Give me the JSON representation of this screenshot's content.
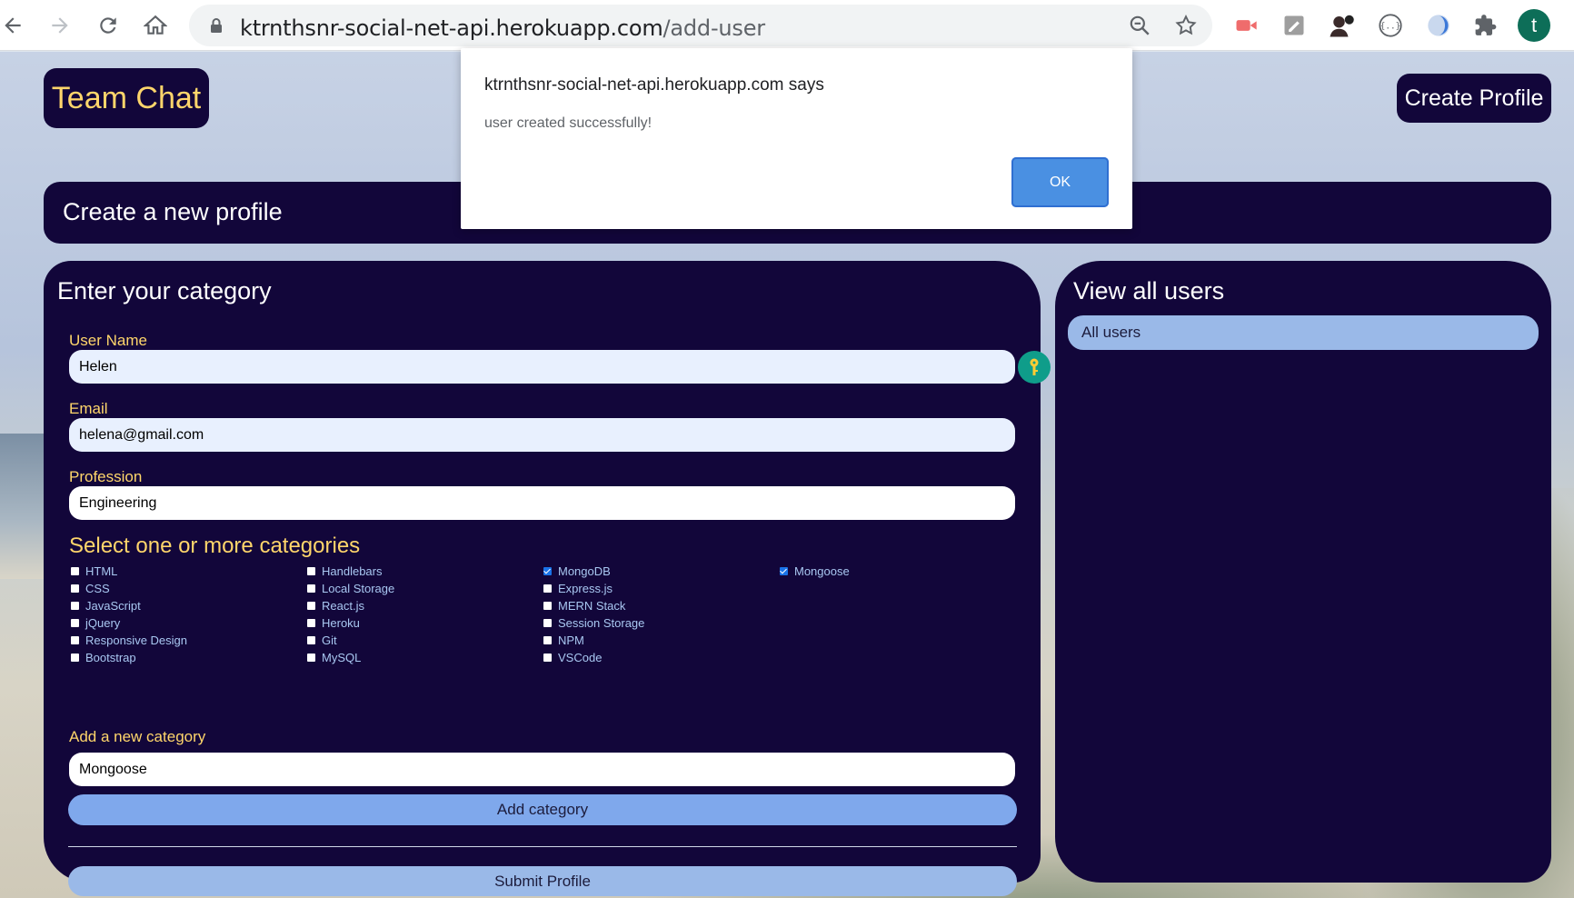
{
  "browser": {
    "url_host": "ktrnthsnr-social-net-api.herokuapp.com",
    "url_path": "/add-user",
    "profile_initial": "t",
    "icons": [
      "back-icon",
      "forward-icon",
      "reload-icon",
      "home-icon",
      "lock-icon",
      "zoom-icon",
      "star-icon",
      "extensions-icon"
    ]
  },
  "header": {
    "brand": "Team Chat",
    "create_profile": "Create Profile"
  },
  "page_title": "Create a new profile",
  "form": {
    "title": "Enter your category",
    "username_label": "User Name",
    "username_value": "Helen",
    "email_label": "Email",
    "email_value": "helena@gmail.com",
    "profession_label": "Profession",
    "profession_value": "Engineering",
    "categories_title": "Select one or more categories",
    "categories": [
      {
        "label": "HTML",
        "checked": false
      },
      {
        "label": "CSS",
        "checked": false
      },
      {
        "label": "JavaScript",
        "checked": false
      },
      {
        "label": "jQuery",
        "checked": false
      },
      {
        "label": "Responsive Design",
        "checked": false
      },
      {
        "label": "Bootstrap",
        "checked": false
      },
      {
        "label": "Handlebars",
        "checked": false
      },
      {
        "label": "Local Storage",
        "checked": false
      },
      {
        "label": "React.js",
        "checked": false
      },
      {
        "label": "Heroku",
        "checked": false
      },
      {
        "label": "Git",
        "checked": false
      },
      {
        "label": "MySQL",
        "checked": false
      },
      {
        "label": "MongoDB",
        "checked": true
      },
      {
        "label": "Express.js",
        "checked": false
      },
      {
        "label": "MERN Stack",
        "checked": false
      },
      {
        "label": "Session Storage",
        "checked": false
      },
      {
        "label": "NPM",
        "checked": false
      },
      {
        "label": "VSCode",
        "checked": false
      },
      {
        "label": "Mongoose",
        "checked": true
      }
    ],
    "new_category_label": "Add a new category",
    "new_category_value": "Mongoose",
    "add_category_button": "Add category",
    "submit_button": "Submit Profile"
  },
  "users_panel": {
    "title": "View all users",
    "all_users_button": "All users"
  },
  "dialog": {
    "title": "ktrnthsnr-social-net-api.herokuapp.com says",
    "message": "user created successfully!",
    "ok": "OK"
  },
  "colors": {
    "panel": "#12063a",
    "accent_text": "#ffd66b",
    "button_blue": "#7fa8ec",
    "dialog_ok": "#4a90e2"
  }
}
